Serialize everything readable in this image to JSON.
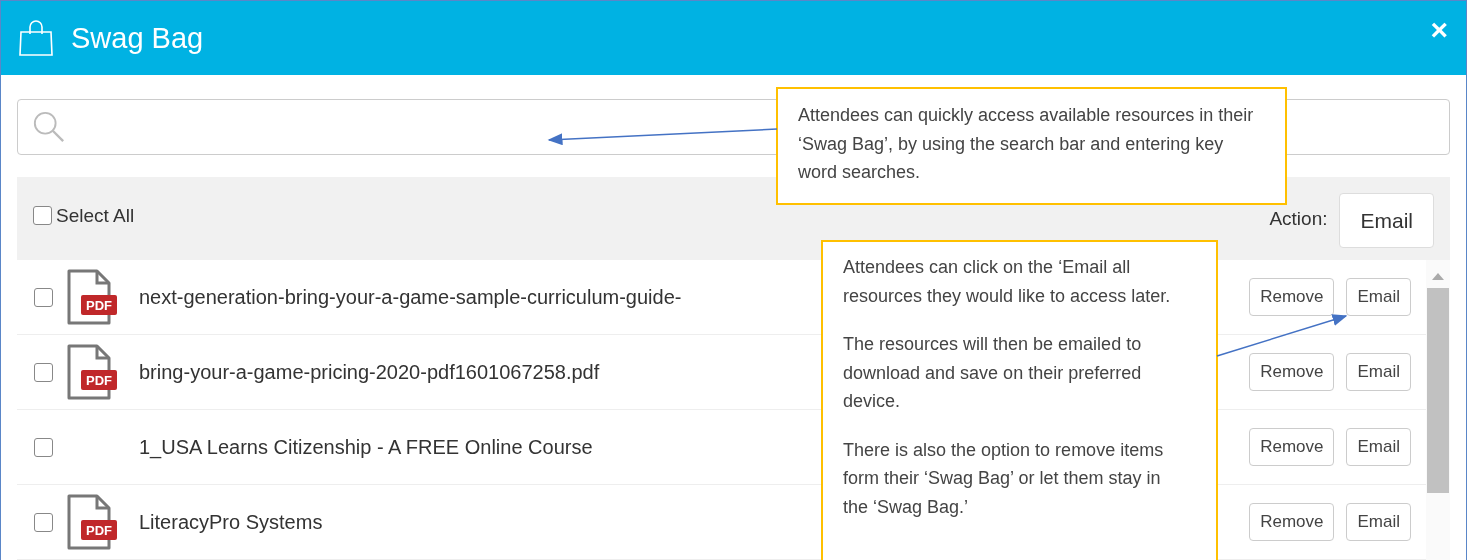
{
  "window": {
    "title": "Swag Bag",
    "close": "×"
  },
  "toolbar": {
    "select_all": {
      "label": "Select All",
      "checked": false
    },
    "action_label": "Action:",
    "action_button": "Email"
  },
  "items": [
    {
      "name": "next-generation-bring-your-a-game-sample-curriculum-guide-",
      "kind": "pdf",
      "badge": "PDF",
      "checked": false,
      "remove": "Remove",
      "email": "Email"
    },
    {
      "name": "bring-your-a-game-pricing-2020-pdf1601067258.pdf",
      "kind": "pdf",
      "badge": "PDF",
      "checked": false,
      "remove": "Remove",
      "email": "Email"
    },
    {
      "name": "1_USA Learns Citizenship - A FREE Online Course",
      "kind": "link",
      "checked": false,
      "remove": "Remove",
      "email": "Email"
    },
    {
      "name": "LiteracyPro Systems",
      "kind": "pdf",
      "badge": "PDF",
      "checked": false,
      "remove": "Remove",
      "email": "Email"
    }
  ],
  "callouts": [
    {
      "paragraphs": [
        "Attendees can quickly access available resources in their ‘Swag Bag’, by using the search bar and entering key word searches."
      ]
    },
    {
      "paragraphs": [
        "Attendees can click on the ‘Email all resources they would like to access later.",
        "The resources will then be emailed to download and save on their preferred device.",
        "There is also the option to remove items form their ‘Swag Bag’ or let them stay in the ‘Swag Bag.’"
      ]
    }
  ]
}
